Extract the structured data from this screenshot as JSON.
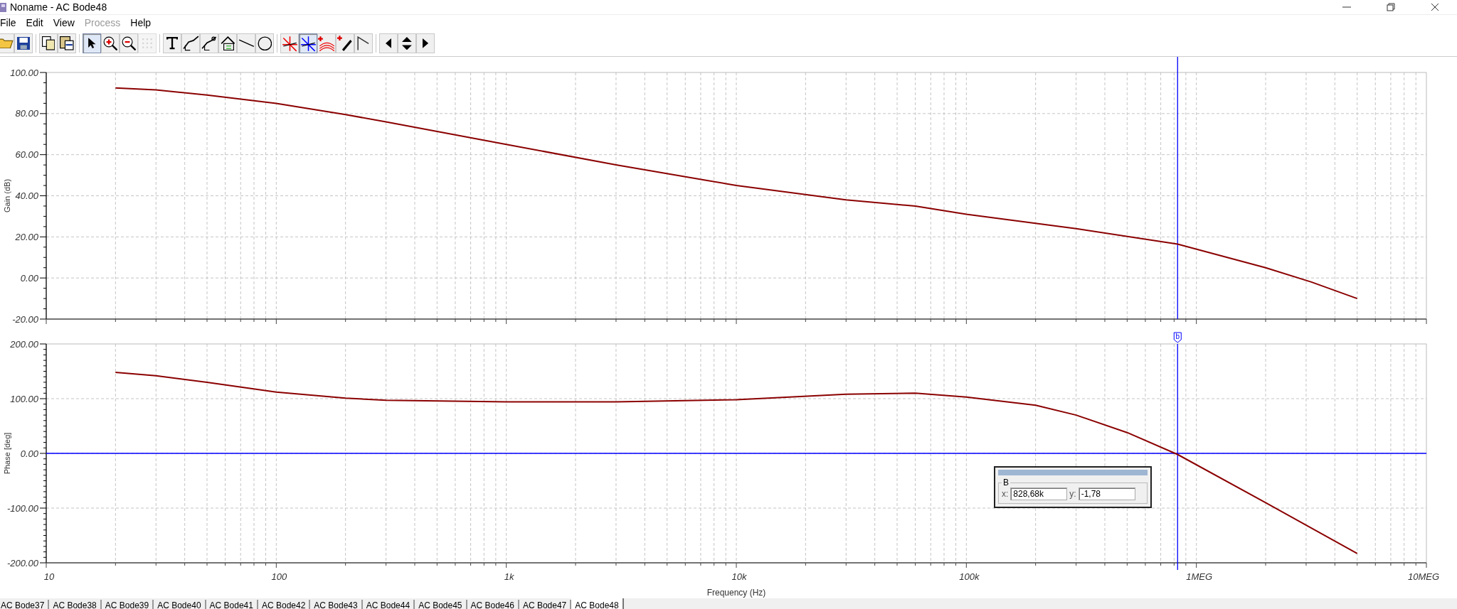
{
  "window": {
    "title": "Noname - AC Bode48"
  },
  "menu": [
    {
      "label": "File",
      "disabled": false
    },
    {
      "label": "Edit",
      "disabled": false
    },
    {
      "label": "View",
      "disabled": false
    },
    {
      "label": "Process",
      "disabled": true
    },
    {
      "label": "Help",
      "disabled": false
    }
  ],
  "toolbar": [
    {
      "kind": "open",
      "pressed": false,
      "disabled": false
    },
    {
      "kind": "save",
      "pressed": false,
      "disabled": false
    },
    {
      "kind": "separator"
    },
    {
      "kind": "copy",
      "pressed": false,
      "disabled": false
    },
    {
      "kind": "paste",
      "pressed": false,
      "disabled": false
    },
    {
      "kind": "separator"
    },
    {
      "kind": "pointer",
      "pressed": true,
      "disabled": false
    },
    {
      "kind": "zoomin",
      "pressed": false,
      "disabled": false
    },
    {
      "kind": "zoomout",
      "pressed": false,
      "disabled": false
    },
    {
      "kind": "grid",
      "pressed": false,
      "disabled": true
    },
    {
      "kind": "separator"
    },
    {
      "kind": "text",
      "pressed": false,
      "disabled": false
    },
    {
      "kind": "curve1",
      "pressed": false,
      "disabled": false
    },
    {
      "kind": "curve2",
      "pressed": false,
      "disabled": false
    },
    {
      "kind": "curve3",
      "pressed": false,
      "disabled": false
    },
    {
      "kind": "line",
      "pressed": false,
      "disabled": false
    },
    {
      "kind": "circle",
      "pressed": false,
      "disabled": false
    },
    {
      "kind": "separator"
    },
    {
      "kind": "cursora",
      "pressed": false,
      "disabled": false
    },
    {
      "kind": "cursorb",
      "pressed": true,
      "disabled": false
    },
    {
      "kind": "addcurve",
      "pressed": false,
      "disabled": false
    },
    {
      "kind": "picker",
      "pressed": false,
      "disabled": false
    },
    {
      "kind": "corner",
      "pressed": false,
      "disabled": false
    },
    {
      "kind": "separator"
    },
    {
      "kind": "left",
      "pressed": false,
      "disabled": false
    },
    {
      "kind": "updown",
      "pressed": false,
      "disabled": false
    },
    {
      "kind": "right",
      "pressed": false,
      "disabled": false
    }
  ],
  "gain_plot": {
    "y_axis_title": "Gain (dB)",
    "y_ticks": [
      "100.00",
      "80.00",
      "60.00",
      "40.00",
      "20.00",
      "0.00",
      "-20.00"
    ]
  },
  "phase_plot": {
    "y_axis_title": "Phase [deg]",
    "y_ticks": [
      "200.00",
      "100.00",
      "0.00",
      "-100.00",
      "-200.00"
    ],
    "cursor_flag": "b",
    "x_ticks": [
      "10",
      "100",
      "1k",
      "10k",
      "100k",
      "1MEG",
      "10MEG"
    ],
    "x_axis_title": "Frequency (Hz)"
  },
  "cursor_box": {
    "group": "B",
    "x_label": "x:",
    "x_value": "828,68k",
    "y_label": "y:",
    "y_value": "-1,78"
  },
  "tabs": [
    {
      "label": "AC Bode37",
      "selected": false
    },
    {
      "label": "AC Bode38",
      "selected": false
    },
    {
      "label": "AC Bode39",
      "selected": false
    },
    {
      "label": "AC Bode40",
      "selected": false
    },
    {
      "label": "AC Bode41",
      "selected": false
    },
    {
      "label": "AC Bode42",
      "selected": false
    },
    {
      "label": "AC Bode43",
      "selected": false
    },
    {
      "label": "AC Bode44",
      "selected": false
    },
    {
      "label": "AC Bode45",
      "selected": false
    },
    {
      "label": "AC Bode46",
      "selected": false
    },
    {
      "label": "AC Bode47",
      "selected": false
    },
    {
      "label": "AC Bode48",
      "selected": true
    }
  ]
}
